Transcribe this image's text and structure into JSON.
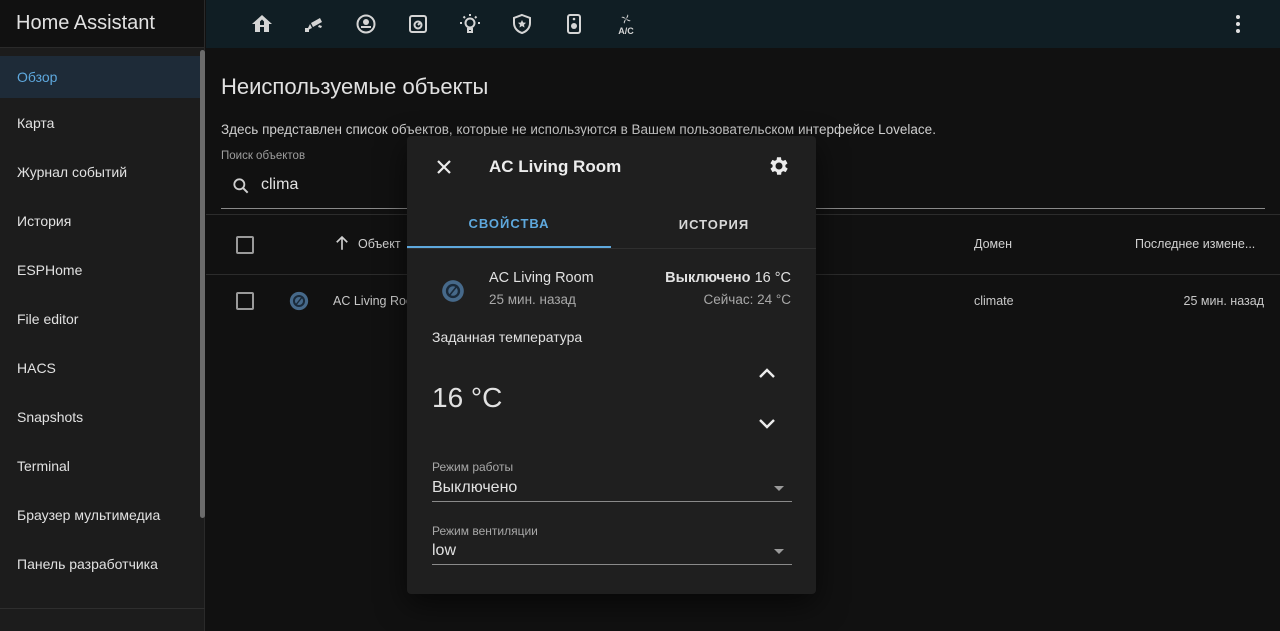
{
  "app": {
    "title": "Home Assistant"
  },
  "sidebar": {
    "items": [
      {
        "label": "Обзор",
        "active": true
      },
      {
        "label": "Карта"
      },
      {
        "label": "Журнал событий"
      },
      {
        "label": "История"
      },
      {
        "label": "ESPHome"
      },
      {
        "label": "File editor"
      },
      {
        "label": "HACS"
      },
      {
        "label": "Snapshots"
      },
      {
        "label": "Terminal"
      },
      {
        "label": "Браузер мультимедиа"
      },
      {
        "label": "Панель разработчика"
      }
    ]
  },
  "topbar": {
    "icons": [
      "home-icon",
      "cctv-icon",
      "robot-vacuum-icon",
      "energy-icon",
      "lightbulb-icon",
      "shield-icon",
      "speaker-icon",
      "air-conditioner-icon"
    ],
    "ac_label": "A/C"
  },
  "page": {
    "title": "Неиспользуемые объекты",
    "description": "Здесь представлен список объектов, которые не используются в Вашем пользовательском интерфейсе Lovelace.",
    "search": {
      "label": "Поиск объектов",
      "value": "clima"
    }
  },
  "table": {
    "headers": {
      "object": "Объект",
      "domain": "Домен",
      "last_changed": "Последнее измене..."
    },
    "rows": [
      {
        "name": "AC Living Room",
        "domain": "climate",
        "last_changed": "25 мин. назад"
      }
    ]
  },
  "dialog": {
    "title": "AC Living Room",
    "tabs": {
      "properties": "СВОЙСТВА",
      "history": "ИСТОРИЯ"
    },
    "entity": {
      "name": "AC Living Room",
      "time": "25 мин. назад",
      "state": "Выключено",
      "state_temp": "16 °C",
      "current": "Сейчас: 24 °C"
    },
    "target_label": "Заданная температура",
    "target_value": "16 °C",
    "mode": {
      "label": "Режим работы",
      "value": "Выключено"
    },
    "fan": {
      "label": "Режим вентиляции",
      "value": "low"
    }
  },
  "colors": {
    "accent": "#5ea8dd",
    "topbar": "#101e24",
    "sidebar": "#1c1c1c",
    "dialog": "#1f1f1f"
  }
}
